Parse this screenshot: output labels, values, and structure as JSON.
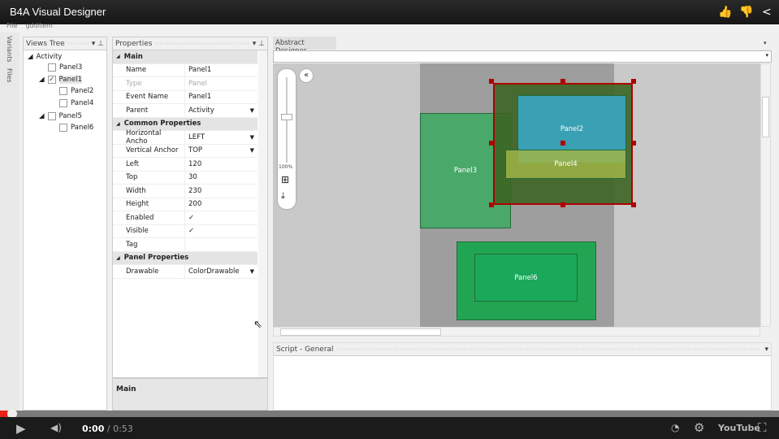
{
  "video": {
    "title": "B4A Visual Designer",
    "time_current": "0:00",
    "time_total": "0:53",
    "progress": 0.0,
    "brand": "YouTube",
    "accent": "#e62117"
  },
  "menu": [
    "File",
    "gdditem"
  ],
  "side_tabs": [
    "Variants",
    "Files"
  ],
  "views_tree": {
    "title": "Views Tree",
    "items": [
      {
        "label": "Activity",
        "level": 0,
        "expanded": true,
        "checkbox": false
      },
      {
        "label": "Panel3",
        "level": 1,
        "checked": false
      },
      {
        "label": "Panel1",
        "level": 1,
        "checked": true,
        "expanded": true
      },
      {
        "label": "Panel2",
        "level": 2,
        "checked": false
      },
      {
        "label": "Panel4",
        "level": 2,
        "checked": false
      },
      {
        "label": "Panel5",
        "level": 1,
        "checked": false,
        "expanded": true
      },
      {
        "label": "Panel6",
        "level": 2,
        "checked": false
      }
    ]
  },
  "properties": {
    "title": "Properties",
    "rows": [
      {
        "cat": "Main"
      },
      {
        "k": "Name",
        "v": "Panel1"
      },
      {
        "k": "Type",
        "v": "Panel",
        "disabled": true
      },
      {
        "k": "Event Name",
        "v": "Panel1"
      },
      {
        "k": "Parent",
        "v": "Activity",
        "dropdown": true
      },
      {
        "cat": "Common Properties"
      },
      {
        "k": "Horizontal Ancho",
        "v": "LEFT",
        "dropdown": true
      },
      {
        "k": "Vertical Anchor",
        "v": "TOP",
        "dropdown": true
      },
      {
        "k": "Left",
        "v": "120"
      },
      {
        "k": "Top",
        "v": "30"
      },
      {
        "k": "Width",
        "v": "230"
      },
      {
        "k": "Height",
        "v": "200"
      },
      {
        "k": "Enabled",
        "v": "✓"
      },
      {
        "k": "Visible",
        "v": "✓"
      },
      {
        "k": "Tag",
        "v": ""
      },
      {
        "cat": "Panel Properties"
      },
      {
        "k": "Drawable",
        "v": "ColorDrawable",
        "dropdown": true
      }
    ],
    "description": "Main"
  },
  "designer": {
    "tab": "Abstract Designer",
    "zoom": "100%",
    "script_title": "Script - General",
    "panels": {
      "panel3": "Panel3",
      "panel1": "Panel1",
      "panel2": "Panel2",
      "panel4": "Panel4",
      "panel6": "Panel6"
    },
    "colors": {
      "panel3": "#4aa86a",
      "panel1": "#4a6e2e",
      "panel2": "#3aa0b4",
      "panel4": "#8fa84a",
      "panel5": "#22a552",
      "panel6": "#1aa85a",
      "selection": "#b00000"
    }
  }
}
